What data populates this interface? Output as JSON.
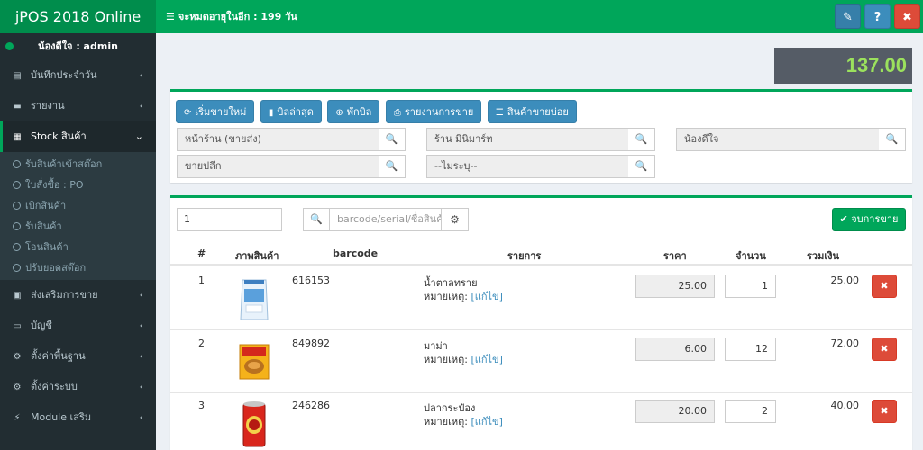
{
  "app": {
    "title": "jPOS 2018 Online",
    "expiry_text": "จะหมดอายุในอีก : 199 วัน"
  },
  "header_buttons": {
    "edit": "✎",
    "help": "?",
    "close": "✖"
  },
  "sidebar": {
    "user": "น้องดีใจ : admin",
    "items": [
      {
        "label": "บันทึกประจำวัน",
        "icon": "▤"
      },
      {
        "label": "รายงาน",
        "icon": "▬"
      },
      {
        "label": "Stock สินค้า",
        "icon": "▦"
      }
    ],
    "submenu": [
      "รับสินค้าเข้าสต๊อก",
      "ใบสั่งซื้อ : PO",
      "เบิกสินค้า",
      "รับสินค้า",
      "โอนสินค้า",
      "ปรับยอดสต๊อก"
    ],
    "items_after": [
      {
        "label": "ส่งเสริมการขาย",
        "icon": "▣"
      },
      {
        "label": "บัญชี",
        "icon": "▭"
      },
      {
        "label": "ตั้งค่าพื้นฐาน",
        "icon": "⚙"
      },
      {
        "label": "ตั้งค่าระบบ",
        "icon": "⚙"
      },
      {
        "label": "Module เสริม",
        "icon": "⚡"
      }
    ]
  },
  "total": "137.00",
  "toolbar": {
    "new_sale": "เริ่มขายใหม่",
    "last_bill": "บิลล่าสุด",
    "hold_bill": "พักบิล",
    "sales_report": "รายงานการขาย",
    "best_sellers": "สินค้าขายบ่อย"
  },
  "selectors": {
    "branch": "หน้าร้าน (ขายส่ง)",
    "store": "ร้าน มินิมาร์ท",
    "employee": "น้องดีใจ",
    "sale_type": "ขายปลีก",
    "customer": "--ไม่ระบุ--"
  },
  "entry": {
    "qty": "1",
    "barcode_placeholder": "barcode/serial/ชื่อสินค้า",
    "finish": "จบการขาย"
  },
  "table": {
    "headers": {
      "num": "#",
      "image": "ภาพสินค้า",
      "barcode": "barcode",
      "item": "รายการ",
      "price": "ราคา",
      "qty": "จำนวน",
      "sum": "รวมเงิน"
    },
    "note_label": "หมายเหตุ:",
    "edit_label": "[แก้ไข]",
    "rows": [
      {
        "num": "1",
        "barcode": "616153",
        "name": "น้ำตาลทราย",
        "price": "25.00",
        "qty": "1",
        "sum": "25.00"
      },
      {
        "num": "2",
        "barcode": "849892",
        "name": "มาม่า",
        "price": "6.00",
        "qty": "12",
        "sum": "72.00"
      },
      {
        "num": "3",
        "barcode": "246286",
        "name": "ปลากระป๋อง",
        "price": "20.00",
        "qty": "2",
        "sum": "40.00"
      }
    ]
  }
}
